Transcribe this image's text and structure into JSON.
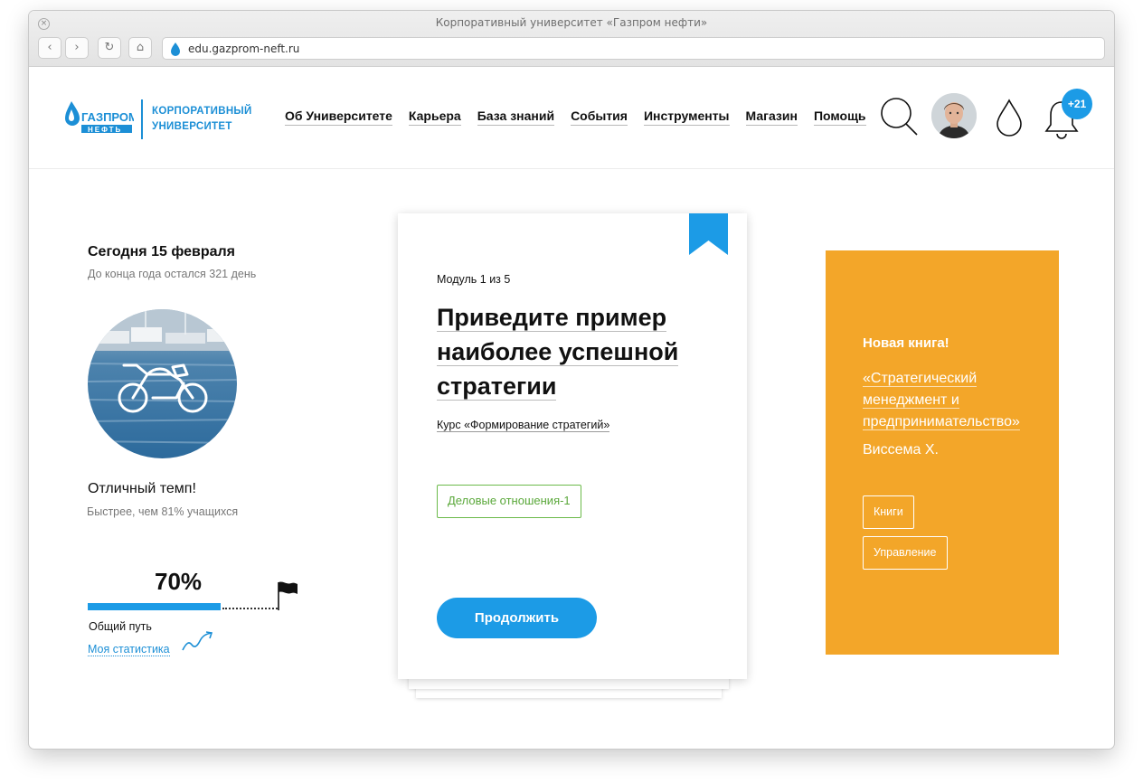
{
  "browser": {
    "window_title": "Корпоративный университет «Газпром нефти»",
    "url": "edu.gazprom-neft.ru",
    "close_glyph": "×",
    "back_glyph": "‹",
    "forward_glyph": "›",
    "reload_glyph": "↻",
    "home_glyph": "⌂"
  },
  "header": {
    "logo": {
      "brand_top": "ГАЗПРОМ",
      "brand_bottom": "НЕФТЬ",
      "line1": "КОРПОРАТИВНЫЙ",
      "line2": "УНИВЕРСИТЕТ"
    },
    "menu": [
      {
        "label": "Об Университете"
      },
      {
        "label": "Карьера"
      },
      {
        "label": "База знаний"
      },
      {
        "label": "События"
      },
      {
        "label": "Инструменты"
      },
      {
        "label": "Магазин"
      },
      {
        "label": "Помощь"
      }
    ],
    "icons": [
      "search-icon",
      "avatar",
      "drop-icon",
      "bell-icon"
    ],
    "notifications_badge": "+21"
  },
  "left_panel": {
    "today": "Сегодня 15 февраля",
    "year_left": "До конца года остался 321 день",
    "pace_icon": "motorcycle-icon",
    "pace_title": "Отличный темп!",
    "pace_sub": "Быстрее, чем 81% учащихся",
    "progress_value": "70%",
    "progress_fraction": 0.7,
    "progress_label": "Общий путь",
    "stats_link": "Моя статистика"
  },
  "card": {
    "module": "Модуль 1 из 5",
    "question": "Приведите пример наиболее успешной стратегии",
    "course": "Курс «Формирование стратегий»",
    "tag": "Деловые отношения-1",
    "continue": "Продолжить"
  },
  "promo": {
    "title": "Новая книга!",
    "book": "«Стратегический менеджмент и предпринимательство»",
    "author": "Виссема Х.",
    "tags": [
      "Книги",
      "Управление"
    ]
  },
  "colors": {
    "accent": "#1c9be6",
    "promo_bg": "#f3a629",
    "tag_green": "#6cba4a"
  }
}
